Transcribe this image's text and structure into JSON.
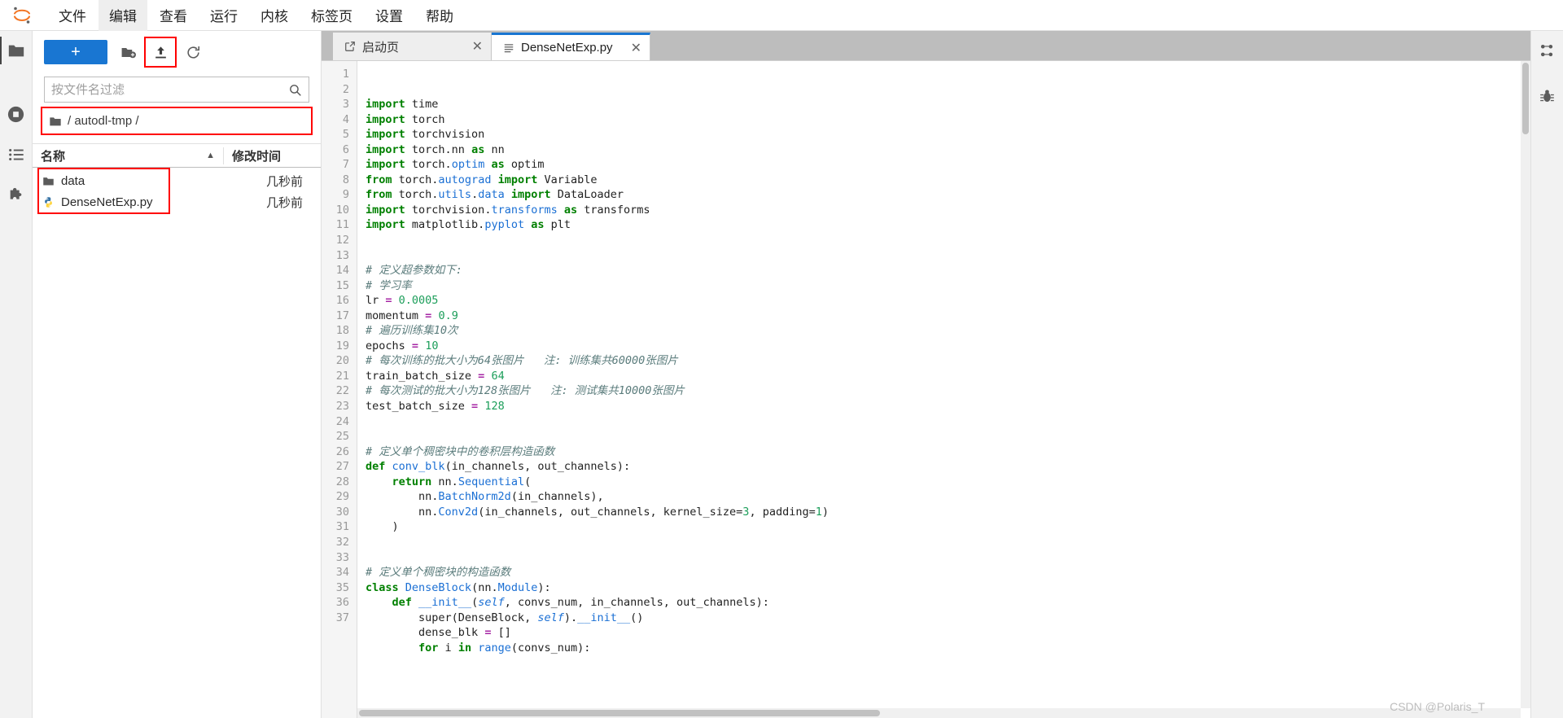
{
  "app": {
    "logo_icon": "jupyter-logo-icon",
    "watermark": "CSDN @Polaris_T"
  },
  "menubar": {
    "items": [
      {
        "label": "文件",
        "name": "menu-file",
        "active": false
      },
      {
        "label": "编辑",
        "name": "menu-edit",
        "active": true
      },
      {
        "label": "查看",
        "name": "menu-view",
        "active": false
      },
      {
        "label": "运行",
        "name": "menu-run",
        "active": false
      },
      {
        "label": "内核",
        "name": "menu-kernel",
        "active": false
      },
      {
        "label": "标签页",
        "name": "menu-tabs",
        "active": false
      },
      {
        "label": "设置",
        "name": "menu-settings",
        "active": false
      },
      {
        "label": "帮助",
        "name": "menu-help",
        "active": false
      }
    ]
  },
  "left_activitybar": {
    "items": [
      {
        "icon": "folder-icon",
        "name": "sidebar-item-file-browser",
        "selected": true
      },
      {
        "icon": "stop-circle-icon",
        "name": "sidebar-item-running",
        "selected": false
      },
      {
        "icon": "list-icon",
        "name": "sidebar-item-commands",
        "selected": false
      },
      {
        "icon": "puzzle-icon",
        "name": "sidebar-item-extensions",
        "selected": false
      }
    ]
  },
  "right_activitybar": {
    "items": [
      {
        "icon": "property-inspector-icon",
        "name": "sidebar-item-property-inspector"
      },
      {
        "icon": "debugger-bug-icon",
        "name": "sidebar-item-debugger"
      }
    ]
  },
  "filebrowser": {
    "toolbar": {
      "new_launcher_label": "+",
      "new_folder_icon": "new-folder-icon",
      "upload_icon": "upload-icon",
      "refresh_icon": "refresh-icon"
    },
    "filter": {
      "placeholder": "按文件名过滤",
      "value": "",
      "search_icon": "search-icon"
    },
    "breadcrumb": {
      "folder_icon": "folder-icon",
      "path": "/ autodl-tmp /"
    },
    "columns": {
      "name": "名称",
      "modified": "修改时间",
      "sort_caret": "▲"
    },
    "rows": [
      {
        "icon": "folder-icon",
        "name": "data",
        "modified": "几秒前"
      },
      {
        "icon": "python-file-icon",
        "name": "DenseNetExp.py",
        "modified": "几秒前"
      }
    ]
  },
  "tabbar": {
    "tabs": [
      {
        "label": "启动页",
        "icon": "launcher-icon",
        "close": "✕",
        "active": false
      },
      {
        "label": "DenseNetExp.py",
        "icon": "text-file-icon",
        "close": "✕",
        "active": true
      }
    ]
  },
  "editor": {
    "first_line": 1,
    "last_line": 37,
    "lines": [
      {
        "n": 1,
        "tokens": [
          {
            "t": "import",
            "c": "kw"
          },
          {
            "t": " time",
            "c": ""
          }
        ]
      },
      {
        "n": 2,
        "tokens": [
          {
            "t": "import",
            "c": "kw"
          },
          {
            "t": " torch",
            "c": ""
          }
        ]
      },
      {
        "n": 3,
        "tokens": [
          {
            "t": "import",
            "c": "kw"
          },
          {
            "t": " torchvision",
            "c": ""
          }
        ]
      },
      {
        "n": 4,
        "tokens": [
          {
            "t": "import",
            "c": "kw"
          },
          {
            "t": " torch.nn ",
            "c": ""
          },
          {
            "t": "as",
            "c": "kw"
          },
          {
            "t": " nn",
            "c": ""
          }
        ]
      },
      {
        "n": 5,
        "tokens": [
          {
            "t": "import",
            "c": "kw"
          },
          {
            "t": " torch.",
            "c": ""
          },
          {
            "t": "optim",
            "c": "bi"
          },
          {
            "t": " ",
            "c": ""
          },
          {
            "t": "as",
            "c": "kw"
          },
          {
            "t": " optim",
            "c": ""
          }
        ]
      },
      {
        "n": 6,
        "tokens": [
          {
            "t": "from",
            "c": "kw"
          },
          {
            "t": " torch.",
            "c": ""
          },
          {
            "t": "autograd",
            "c": "bi"
          },
          {
            "t": " ",
            "c": ""
          },
          {
            "t": "import",
            "c": "kw"
          },
          {
            "t": " Variable",
            "c": ""
          }
        ]
      },
      {
        "n": 7,
        "tokens": [
          {
            "t": "from",
            "c": "kw"
          },
          {
            "t": " torch.",
            "c": ""
          },
          {
            "t": "utils",
            "c": "bi"
          },
          {
            "t": ".",
            "c": ""
          },
          {
            "t": "data",
            "c": "bi"
          },
          {
            "t": " ",
            "c": ""
          },
          {
            "t": "import",
            "c": "kw"
          },
          {
            "t": " DataLoader",
            "c": ""
          }
        ]
      },
      {
        "n": 8,
        "tokens": [
          {
            "t": "import",
            "c": "kw"
          },
          {
            "t": " torchvision.",
            "c": ""
          },
          {
            "t": "transforms",
            "c": "bi"
          },
          {
            "t": " ",
            "c": ""
          },
          {
            "t": "as",
            "c": "kw"
          },
          {
            "t": " transforms",
            "c": ""
          }
        ]
      },
      {
        "n": 9,
        "tokens": [
          {
            "t": "import",
            "c": "kw"
          },
          {
            "t": " matplotlib.",
            "c": ""
          },
          {
            "t": "pyplot",
            "c": "bi"
          },
          {
            "t": " ",
            "c": ""
          },
          {
            "t": "as",
            "c": "kw"
          },
          {
            "t": " plt",
            "c": ""
          }
        ]
      },
      {
        "n": 10,
        "tokens": []
      },
      {
        "n": 11,
        "tokens": []
      },
      {
        "n": 12,
        "tokens": [
          {
            "t": "# 定义超参数如下:",
            "c": "cm"
          }
        ]
      },
      {
        "n": 13,
        "tokens": [
          {
            "t": "# 学习率",
            "c": "cm"
          }
        ]
      },
      {
        "n": 14,
        "tokens": [
          {
            "t": "lr ",
            "c": ""
          },
          {
            "t": "=",
            "c": "op"
          },
          {
            "t": " ",
            "c": ""
          },
          {
            "t": "0.0005",
            "c": "num"
          }
        ]
      },
      {
        "n": 15,
        "tokens": [
          {
            "t": "momentum ",
            "c": ""
          },
          {
            "t": "=",
            "c": "op"
          },
          {
            "t": " ",
            "c": ""
          },
          {
            "t": "0.9",
            "c": "num"
          }
        ]
      },
      {
        "n": 16,
        "tokens": [
          {
            "t": "# 遍历训练集10次",
            "c": "cm"
          }
        ]
      },
      {
        "n": 17,
        "tokens": [
          {
            "t": "epochs ",
            "c": ""
          },
          {
            "t": "=",
            "c": "op"
          },
          {
            "t": " ",
            "c": ""
          },
          {
            "t": "10",
            "c": "num"
          }
        ]
      },
      {
        "n": 18,
        "tokens": [
          {
            "t": "# 每次训练的批大小为64张图片   注: 训练集共60000张图片",
            "c": "cm"
          }
        ]
      },
      {
        "n": 19,
        "tokens": [
          {
            "t": "train_batch_size ",
            "c": ""
          },
          {
            "t": "=",
            "c": "op"
          },
          {
            "t": " ",
            "c": ""
          },
          {
            "t": "64",
            "c": "num"
          }
        ]
      },
      {
        "n": 20,
        "tokens": [
          {
            "t": "# 每次测试的批大小为128张图片   注: 测试集共10000张图片",
            "c": "cm"
          }
        ]
      },
      {
        "n": 21,
        "tokens": [
          {
            "t": "test_batch_size ",
            "c": ""
          },
          {
            "t": "=",
            "c": "op"
          },
          {
            "t": " ",
            "c": ""
          },
          {
            "t": "128",
            "c": "num"
          }
        ]
      },
      {
        "n": 22,
        "tokens": []
      },
      {
        "n": 23,
        "tokens": []
      },
      {
        "n": 24,
        "tokens": [
          {
            "t": "# 定义单个稠密块中的卷积层构造函数",
            "c": "cm"
          }
        ]
      },
      {
        "n": 25,
        "tokens": [
          {
            "t": "def",
            "c": "kw"
          },
          {
            "t": " ",
            "c": ""
          },
          {
            "t": "conv_blk",
            "c": "bi"
          },
          {
            "t": "(in_channels, out_channels):",
            "c": ""
          }
        ]
      },
      {
        "n": 26,
        "tokens": [
          {
            "t": "    ",
            "c": ""
          },
          {
            "t": "return",
            "c": "kw"
          },
          {
            "t": " nn.",
            "c": ""
          },
          {
            "t": "Sequential",
            "c": "bi"
          },
          {
            "t": "(",
            "c": ""
          }
        ]
      },
      {
        "n": 27,
        "tokens": [
          {
            "t": "        nn.",
            "c": ""
          },
          {
            "t": "BatchNorm2d",
            "c": "bi"
          },
          {
            "t": "(in_channels),",
            "c": ""
          }
        ]
      },
      {
        "n": 28,
        "tokens": [
          {
            "t": "        nn.",
            "c": ""
          },
          {
            "t": "Conv2d",
            "c": "bi"
          },
          {
            "t": "(in_channels, out_channels, kernel_size=",
            "c": ""
          },
          {
            "t": "3",
            "c": "num"
          },
          {
            "t": ", padding=",
            "c": ""
          },
          {
            "t": "1",
            "c": "num"
          },
          {
            "t": ")",
            "c": ""
          }
        ]
      },
      {
        "n": 29,
        "tokens": [
          {
            "t": "    )",
            "c": ""
          }
        ]
      },
      {
        "n": 30,
        "tokens": []
      },
      {
        "n": 31,
        "tokens": []
      },
      {
        "n": 32,
        "tokens": [
          {
            "t": "# 定义单个稠密块的构造函数",
            "c": "cm"
          }
        ]
      },
      {
        "n": 33,
        "tokens": [
          {
            "t": "class",
            "c": "kw"
          },
          {
            "t": " ",
            "c": ""
          },
          {
            "t": "DenseBlock",
            "c": "bi"
          },
          {
            "t": "(nn.",
            "c": ""
          },
          {
            "t": "Module",
            "c": "bi"
          },
          {
            "t": "):",
            "c": ""
          }
        ]
      },
      {
        "n": 34,
        "tokens": [
          {
            "t": "    ",
            "c": ""
          },
          {
            "t": "def",
            "c": "kw"
          },
          {
            "t": " ",
            "c": ""
          },
          {
            "t": "__init__",
            "c": "bi"
          },
          {
            "t": "(",
            "c": ""
          },
          {
            "t": "self",
            "c": "self"
          },
          {
            "t": ", convs_num, in_channels, out_channels):",
            "c": ""
          }
        ]
      },
      {
        "n": 35,
        "tokens": [
          {
            "t": "        super(DenseBlock, ",
            "c": ""
          },
          {
            "t": "self",
            "c": "self"
          },
          {
            "t": ").",
            "c": ""
          },
          {
            "t": "__init__",
            "c": "bi"
          },
          {
            "t": "()",
            "c": ""
          }
        ]
      },
      {
        "n": 36,
        "tokens": [
          {
            "t": "        dense_blk ",
            "c": ""
          },
          {
            "t": "=",
            "c": "op"
          },
          {
            "t": " []",
            "c": ""
          }
        ]
      },
      {
        "n": 37,
        "tokens": [
          {
            "t": "        ",
            "c": ""
          },
          {
            "t": "for",
            "c": "kw"
          },
          {
            "t": " i ",
            "c": ""
          },
          {
            "t": "in",
            "c": "kw"
          },
          {
            "t": " ",
            "c": ""
          },
          {
            "t": "range",
            "c": "bi"
          },
          {
            "t": "(convs_num):",
            "c": ""
          }
        ]
      }
    ]
  },
  "colors": {
    "accent": "#1976d2",
    "annotation": "#ff0000",
    "keyword": "#008000",
    "builtin": "#1a6fd4",
    "number": "#1c9e5a",
    "operator": "#a626a4",
    "comment": "#5c7d7d",
    "tabbar_bg": "#bdbdbd"
  }
}
